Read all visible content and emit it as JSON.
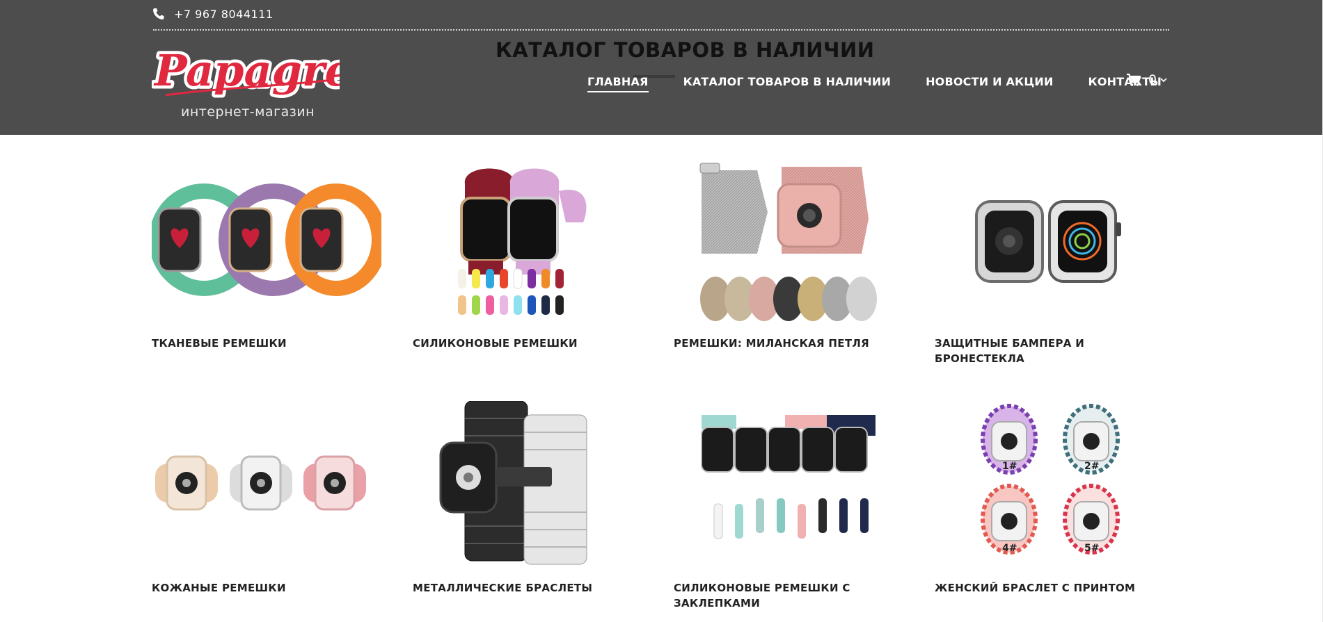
{
  "header": {
    "phone": "+7 967 8044111",
    "logo_text": "Papagrek",
    "logo_tagline": "интернет-магазин",
    "page_title": "КАТАЛОГ ТОВАРОВ В НАЛИЧИИ",
    "nav": [
      {
        "label": "ГЛАВНАЯ",
        "active": true
      },
      {
        "label": "КАТАЛОГ ТОВАРОВ В НАЛИЧИИ",
        "active": false
      },
      {
        "label": "НОВОСТИ И АКЦИИ",
        "active": false
      },
      {
        "label": "КОНТАКТЫ",
        "active": false
      }
    ],
    "cart_count": "0"
  },
  "colors": {
    "header_bg": "#4d4d4d",
    "logo_red": "#e0283f",
    "text_dark": "#222222"
  },
  "products": [
    {
      "title": "ТКАНЕВЫЕ РЕМЕШКИ",
      "icon": "woven-watch-bands-image"
    },
    {
      "title": "СИЛИКОНОВЫЕ РЕМЕШКИ",
      "icon": "silicone-watch-bands-image"
    },
    {
      "title": "РЕМЕШКИ: МИЛАНСКАЯ ПЕТЛЯ",
      "icon": "milanese-loop-bands-image"
    },
    {
      "title": "ЗАЩИТНЫЕ БАМПЕРА И БРОНЕСТЕКЛА",
      "icon": "bumper-cases-image"
    },
    {
      "title": "КОЖАНЫЕ РЕМЕШКИ",
      "icon": "leather-watch-bands-image"
    },
    {
      "title": "МЕТАЛЛИЧЕСКИЕ БРАСЛЕТЫ",
      "icon": "metal-bracelets-image"
    },
    {
      "title": "СИЛИКОНОВЫЕ РЕМЕШКИ С ЗАКЛЕПКАМИ",
      "icon": "studded-silicone-bands-image"
    },
    {
      "title": "ЖЕНСКИЙ БРАСЛЕТ С ПРИНТОМ",
      "icon": "printed-bands-image",
      "variant_labels": [
        "1#",
        "2#",
        "4#",
        "5#"
      ]
    }
  ]
}
